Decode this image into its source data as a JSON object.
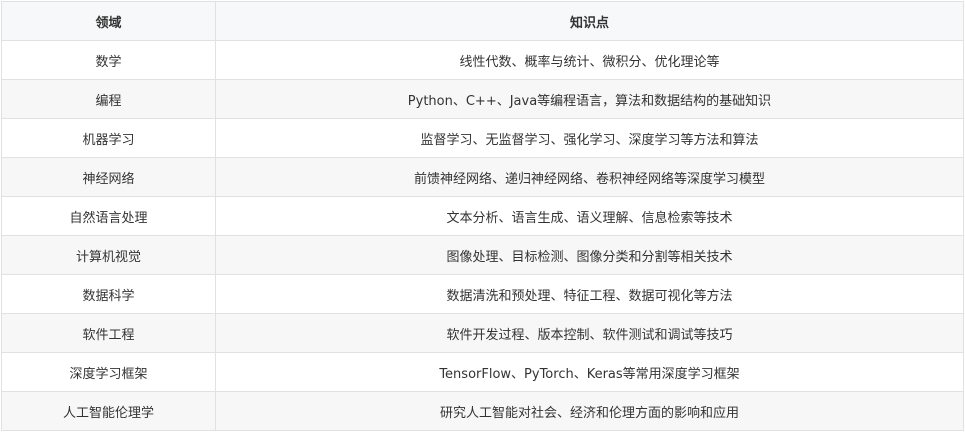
{
  "table": {
    "headers": [
      "领域",
      "知识点"
    ],
    "rows": [
      [
        "数学",
        "线性代数、概率与统计、微积分、优化理论等"
      ],
      [
        "编程",
        "Python、C++、Java等编程语言，算法和数据结构的基础知识"
      ],
      [
        "机器学习",
        "监督学习、无监督学习、强化学习、深度学习等方法和算法"
      ],
      [
        "神经网络",
        "前馈神经网络、递归神经网络、卷积神经网络等深度学习模型"
      ],
      [
        "自然语言处理",
        "文本分析、语言生成、语义理解、信息检索等技术"
      ],
      [
        "计算机视觉",
        "图像处理、目标检测、图像分类和分割等相关技术"
      ],
      [
        "数据科学",
        "数据清洗和预处理、特征工程、数据可视化等方法"
      ],
      [
        "软件工程",
        "软件开发过程、版本控制、软件测试和调试等技巧"
      ],
      [
        "深度学习框架",
        "TensorFlow、PyTorch、Keras等常用深度学习框架"
      ],
      [
        "人工智能伦理学",
        "研究人工智能对社会、经济和伦理方面的影响和应用"
      ]
    ]
  }
}
